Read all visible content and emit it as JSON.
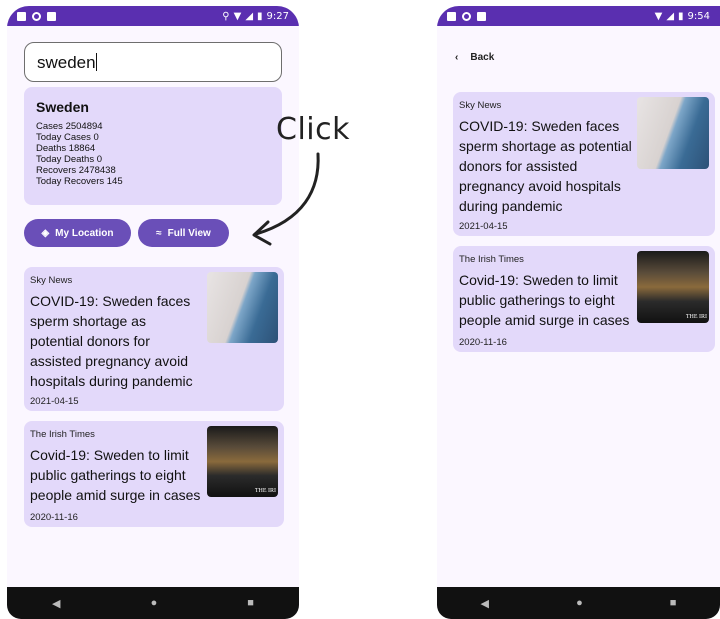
{
  "status": {
    "left_time": "9:27",
    "right_time": "9:54"
  },
  "search": {
    "value": "sweden"
  },
  "stats": {
    "country": "Sweden",
    "lines": [
      "Cases 2504894",
      "Today Cases 0",
      "Deaths 18864",
      "Today Deaths 0",
      "Recovers 2478438",
      "Today Recovers  145"
    ]
  },
  "buttons": {
    "location": "My Location",
    "full_view": "Full View"
  },
  "annotation": {
    "click": "Click"
  },
  "detail": {
    "back": "Back"
  },
  "articles": [
    {
      "source": "Sky News",
      "title": "COVID-19: Sweden faces sperm shortage as potential donors for assisted pregnancy avoid hospitals during pandemic",
      "date": "2021-04-15"
    },
    {
      "source": "The Irish Times",
      "title": "Covid-19: Sweden to limit public gatherings to eight people amid surge in cases",
      "date": "2020-11-16",
      "image_text": "THE IRI"
    }
  ],
  "nav": {
    "back": "◀",
    "home": "●",
    "recents": "■"
  },
  "colors": {
    "statusbar": "#5a2fb0",
    "card": "#e3d9fa",
    "button": "#6a4fb8"
  }
}
